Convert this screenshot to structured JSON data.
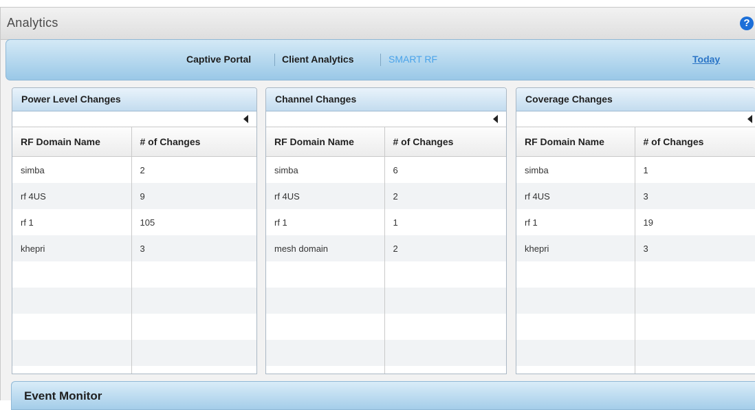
{
  "window": {
    "title": "Analytics",
    "help_icon": "?"
  },
  "nav": {
    "items": [
      {
        "label": "Captive Portal",
        "active": false
      },
      {
        "label": "Client Analytics",
        "active": false
      },
      {
        "label": "SMART RF",
        "active": true
      }
    ],
    "range_link": "Today"
  },
  "panels": [
    {
      "title": "Power Level Changes",
      "columns": [
        "RF Domain Name",
        "# of Changes"
      ],
      "rows": [
        [
          "simba",
          "2"
        ],
        [
          "rf 4US",
          "9"
        ],
        [
          "rf 1",
          "105"
        ],
        [
          "khepri",
          "3"
        ]
      ]
    },
    {
      "title": "Channel Changes",
      "columns": [
        "RF Domain Name",
        "# of Changes"
      ],
      "rows": [
        [
          "simba",
          "6"
        ],
        [
          "rf 4US",
          "2"
        ],
        [
          "rf 1",
          "1"
        ],
        [
          "mesh domain",
          "2"
        ]
      ]
    },
    {
      "title": "Coverage Changes",
      "columns": [
        "RF Domain Name",
        "# of Changes"
      ],
      "rows": [
        [
          "simba",
          "1"
        ],
        [
          "rf 4US",
          "3"
        ],
        [
          "rf 1",
          "19"
        ],
        [
          "khepri",
          "3"
        ]
      ]
    }
  ],
  "event_monitor": {
    "title": "Event Monitor"
  },
  "colors": {
    "active_tab": "#4aa3ea",
    "link": "#2a74c6",
    "help_icon": "#1c6fd8"
  }
}
